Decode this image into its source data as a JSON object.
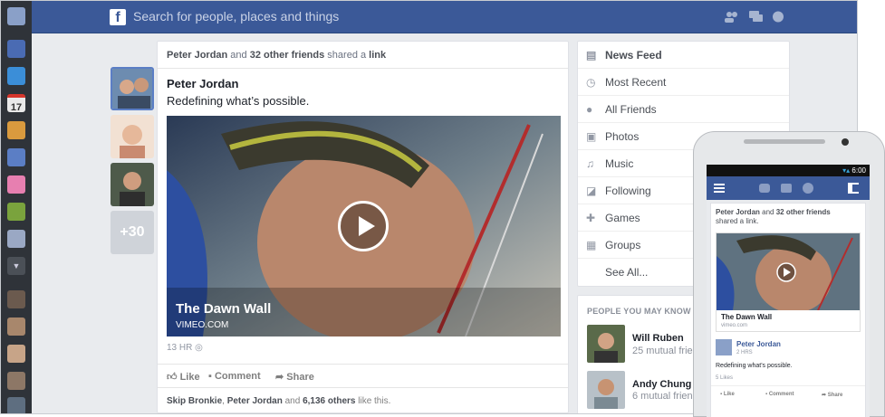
{
  "topbar": {
    "search_placeholder": "Search for people, places and things",
    "logo": "f"
  },
  "left_rail": {
    "items": [
      "profile-avatar",
      "news-icon",
      "messages-icon",
      "events-icon",
      "photos-icon",
      "search-icon",
      "gifts-icon",
      "games-icon",
      "notes-icon",
      "more-arrow-icon",
      "friend-1",
      "friend-2",
      "friend-3",
      "friend-4",
      "friend-5"
    ]
  },
  "friends_stack": {
    "more_label": "+30"
  },
  "post": {
    "header_name": "Peter Jordan",
    "header_mid": " and ",
    "header_friends": "32 other friends",
    "header_shared": " shared a ",
    "header_link": "link",
    "author": "Peter Jordan",
    "text": "Redefining what’s possible.",
    "video_title": "The Dawn Wall",
    "video_source": "VIMEO.COM",
    "time": "13 HR",
    "actions": {
      "like": "Like",
      "comment": "Comment",
      "share": "Share"
    },
    "likes_names": "Skip Bronkie",
    "likes_sep": ", ",
    "likes_name2": "Peter Jordan",
    "likes_and": " and ",
    "likes_count": "6,136 others",
    "likes_tail": " like this."
  },
  "nav": {
    "items": [
      {
        "label": "News Feed",
        "icon": "news-feed-icon"
      },
      {
        "label": "Most Recent",
        "icon": "clock-icon"
      },
      {
        "label": "All Friends",
        "icon": "friends-icon"
      },
      {
        "label": "Photos",
        "icon": "photos-icon"
      },
      {
        "label": "Music",
        "icon": "music-icon"
      },
      {
        "label": "Following",
        "icon": "rss-icon"
      },
      {
        "label": "Games",
        "icon": "games-icon"
      },
      {
        "label": "Groups",
        "icon": "groups-icon"
      }
    ],
    "see_all": "See All..."
  },
  "pymk": {
    "header": "PEOPLE YOU MAY KNOW",
    "people": [
      {
        "name": "Will Ruben",
        "mutual": "25 mutual friends"
      },
      {
        "name": "Andy Chung",
        "mutual": "6 mutual friends"
      }
    ]
  },
  "phone": {
    "time": "6:00",
    "post_header_name": "Peter Jordan",
    "post_header_rest": " and ",
    "post_header_friends": "32 other friends",
    "post_header_tail": "shared a link.",
    "video_title": "The Dawn Wall",
    "video_source": "vimeo.com",
    "author": "Peter Jordan",
    "time_ago": "2 HRS",
    "text": "Redefining what's possible.",
    "likes": "5 Likes",
    "actions": {
      "like": "Like",
      "comment": "Comment",
      "share": "Share"
    }
  },
  "colors": {
    "brand": "#3b5998",
    "left_rail": "#2f3339",
    "page_bg": "#e9ebee"
  }
}
